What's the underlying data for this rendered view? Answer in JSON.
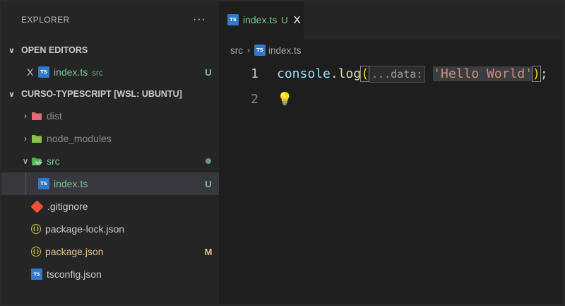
{
  "sidebar": {
    "title": "EXPLORER",
    "more": "···",
    "open_editors": {
      "header": "OPEN EDITORS",
      "items": [
        {
          "close": "X",
          "label": "index.ts",
          "sub": "src",
          "badge": "U"
        }
      ]
    },
    "project": {
      "header": "CURSO-TYPESCRIPT [WSL: UBUNTU]",
      "items": [
        {
          "label": "dist",
          "badge": ""
        },
        {
          "label": "node_modules",
          "badge": ""
        },
        {
          "label": "src",
          "badge": ""
        },
        {
          "label": "index.ts",
          "badge": "U"
        },
        {
          "label": ".gitignore",
          "badge": ""
        },
        {
          "label": "package-lock.json",
          "badge": ""
        },
        {
          "label": "package.json",
          "badge": "M"
        },
        {
          "label": "tsconfig.json",
          "badge": ""
        }
      ]
    }
  },
  "icons": {
    "ts": "TS",
    "json": "{}",
    "tsconfig": "TS"
  },
  "editor": {
    "tab": {
      "label": "index.ts",
      "modified": "U",
      "close": "X"
    },
    "breadcrumb": {
      "folder": "src",
      "sep": "›",
      "file": "index.ts"
    },
    "lines": [
      {
        "number": "1",
        "obj": "console",
        "dot": ".",
        "fn": "log",
        "open": "(",
        "hint": "...data:",
        "str": "'Hello World'",
        "close": ")",
        "end": ";"
      },
      {
        "number": "2",
        "bulb": "💡"
      }
    ]
  }
}
